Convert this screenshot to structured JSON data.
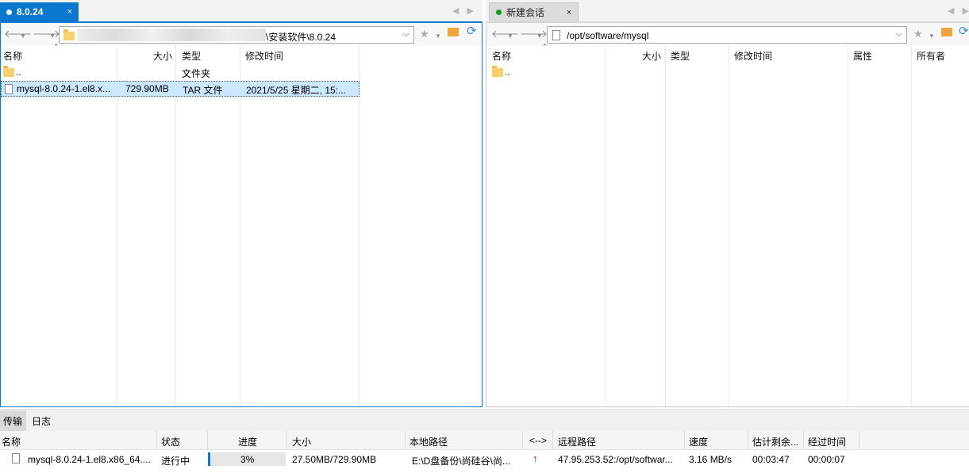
{
  "left_tab": {
    "title": "8.0.24",
    "close": "×"
  },
  "right_tab": {
    "title": "新建会话",
    "close": "×"
  },
  "tab_nav": {
    "prev": "◀",
    "next": "▶"
  },
  "colors": {
    "accent": "#0b78d0",
    "session_dot": "#13a10e",
    "upload_arrow": "#d00000",
    "selection": "#cce8ff"
  },
  "icons": {
    "back": "arrow-left-icon",
    "forward": "arrow-right-icon",
    "dropdown": "chevron-down-icon",
    "bookmark": "star-icon",
    "home": "home-folder-icon",
    "refresh": "refresh-icon",
    "folder": "folder-icon",
    "file": "file-icon",
    "upload": "upload-arrow-icon"
  },
  "left_pane": {
    "address": "\\安装软件\\8.0.24",
    "columns": [
      "名称",
      "大小",
      "类型",
      "修改时间"
    ],
    "rows": [
      {
        "name": "..",
        "size": "",
        "type": "文件夹",
        "modified": ""
      },
      {
        "name": "mysql-8.0.24-1.el8.x...",
        "size": "729.90MB",
        "type": "TAR 文件",
        "modified": "2021/5/25 星期二, 15:..."
      }
    ]
  },
  "right_pane": {
    "address": "/opt/software/mysql",
    "columns": [
      "名称",
      "大小",
      "类型",
      "修改时间",
      "属性",
      "所有者"
    ],
    "rows": [
      {
        "name": ".."
      }
    ]
  },
  "bottom": {
    "tabs": [
      "传输",
      "日志"
    ],
    "columns": [
      "名称",
      "状态",
      "进度",
      "大小",
      "本地路径",
      "<-->",
      "远程路径",
      "速度",
      "估计剩余...",
      "经过时间"
    ],
    "transfer": {
      "name": "mysql-8.0.24-1.el8.x86_64....",
      "status": "进行中",
      "progress": "3%",
      "progress_fraction": 0.03,
      "size": "27.50MB/729.90MB",
      "local_path": "E:\\D盘备份\\尚硅谷\\尚...",
      "direction": "↑",
      "remote_path": "47.95.253.52:/opt/softwar...",
      "speed": "3.16 MB/s",
      "eta": "00:03:47",
      "elapsed": "00:00:07"
    }
  }
}
